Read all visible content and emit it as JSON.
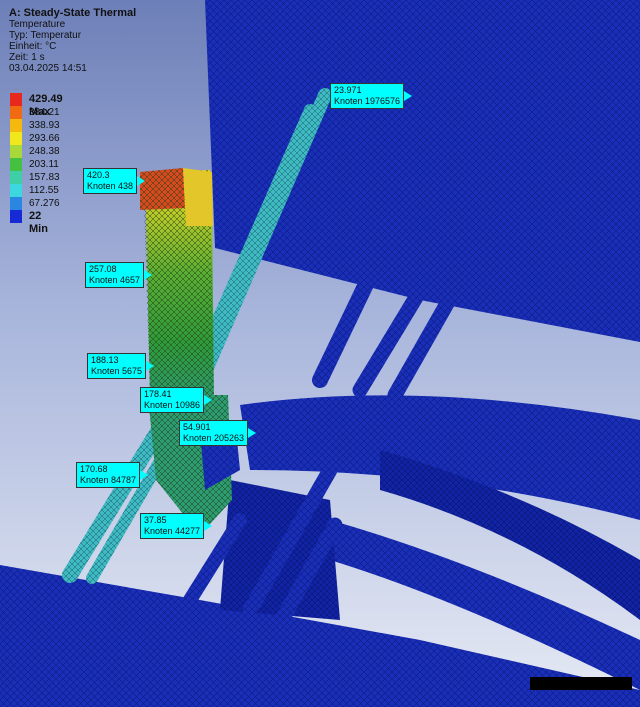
{
  "header": {
    "title": "A: Steady-State Thermal",
    "result": "Temperature",
    "type": "Typ: Temperatur",
    "unit": "Einheit: °C",
    "time": "Zeit: 1 s",
    "date": "03.04.2025 14:51"
  },
  "legend": {
    "max_label": "429.49 Max",
    "min_label": "22 Min",
    "values": [
      "384.21",
      "338.93",
      "293.66",
      "248.38",
      "203.11",
      "157.83",
      "112.55",
      "67.276"
    ],
    "colors": [
      "#e8281d",
      "#f06a12",
      "#f5b80e",
      "#f0e81c",
      "#a8d83a",
      "#45c141",
      "#3fcfa6",
      "#3dd7e0",
      "#2a86e0",
      "#1529d5"
    ]
  },
  "probes": [
    {
      "value": "23.971",
      "node": "Knoten 1976576"
    },
    {
      "value": "420.3",
      "node": "Knoten 438"
    },
    {
      "value": "257.08",
      "node": "Knoten 4657"
    },
    {
      "value": "188.13",
      "node": "Knoten 5675"
    },
    {
      "value": "178.41",
      "node": "Knoten 10986"
    },
    {
      "value": "54.901",
      "node": "Knoten 205263"
    },
    {
      "value": "170.68",
      "node": "Knoten 84787"
    },
    {
      "value": "37.85",
      "node": "Knoten 44277"
    }
  ],
  "colors": {
    "mesh_blue": "#1a2fb8",
    "mesh_dark": "#0c1a8a",
    "probe_bg": "#00ffff"
  }
}
